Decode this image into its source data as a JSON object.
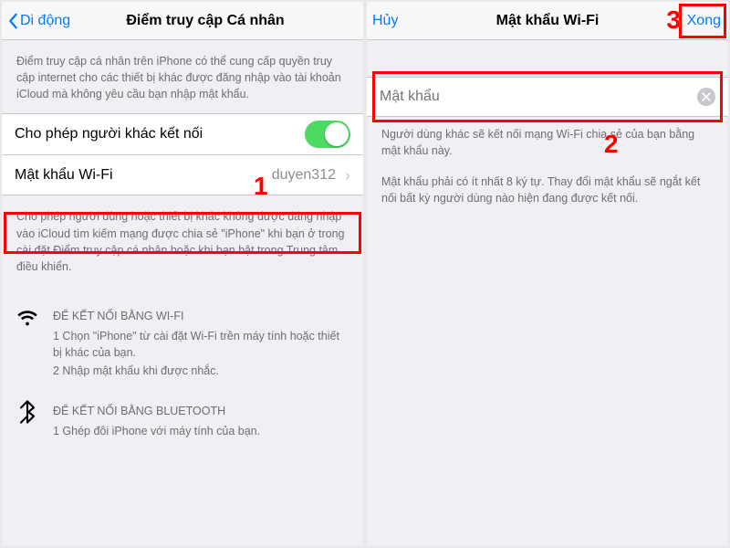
{
  "left": {
    "back_label": "Di động",
    "title": "Điểm truy cập Cá nhân",
    "intro": "Điểm truy cập cá nhân trên iPhone có thể cung cấp quyền truy cập internet cho các thiết bị khác được đăng nhập vào tài khoản iCloud mà không yêu cầu bạn nhập mật khẩu.",
    "allow_label": "Cho phép người khác kết nối",
    "password_label": "Mật khẩu Wi-Fi",
    "password_value": "duyen312",
    "below": "Cho phép người dùng hoặc thiết bị khác không được đăng nhập vào iCloud tìm kiếm mạng được chia sẻ \"iPhone\" khi bạn ở trong cài đặt Điểm truy cập cá nhân hoặc khi bạn bật trong Trung tâm điều khiển.",
    "wifi_title": "ĐỂ KẾT NỐI BẰNG WI-FI",
    "wifi_1": "1 Chọn \"iPhone\" từ cài đặt Wi-Fi trên máy tính hoặc thiết bị khác của bạn.",
    "wifi_2": "2 Nhập mật khẩu khi được nhắc.",
    "bt_title": "ĐỂ KẾT NỐI BẰNG BLUETOOTH",
    "bt_1": "1 Ghép đôi iPhone với máy tính của bạn."
  },
  "right": {
    "cancel": "Hủy",
    "title": "Mật khẩu Wi-Fi",
    "done": "Xong",
    "placeholder": "Mật khẩu",
    "note1": "Người dùng khác sẽ kết nối mạng Wi-Fi chia sẻ của bạn bằng mật khẩu này.",
    "note2": "Mật khẩu phải có ít nhất 8 ký tự. Thay đổi mật khẩu sẽ ngắt kết nối bất kỳ người dùng nào hiện đang được kết nối."
  },
  "annotations": {
    "a1": "1",
    "a2": "2",
    "a3": "3"
  }
}
